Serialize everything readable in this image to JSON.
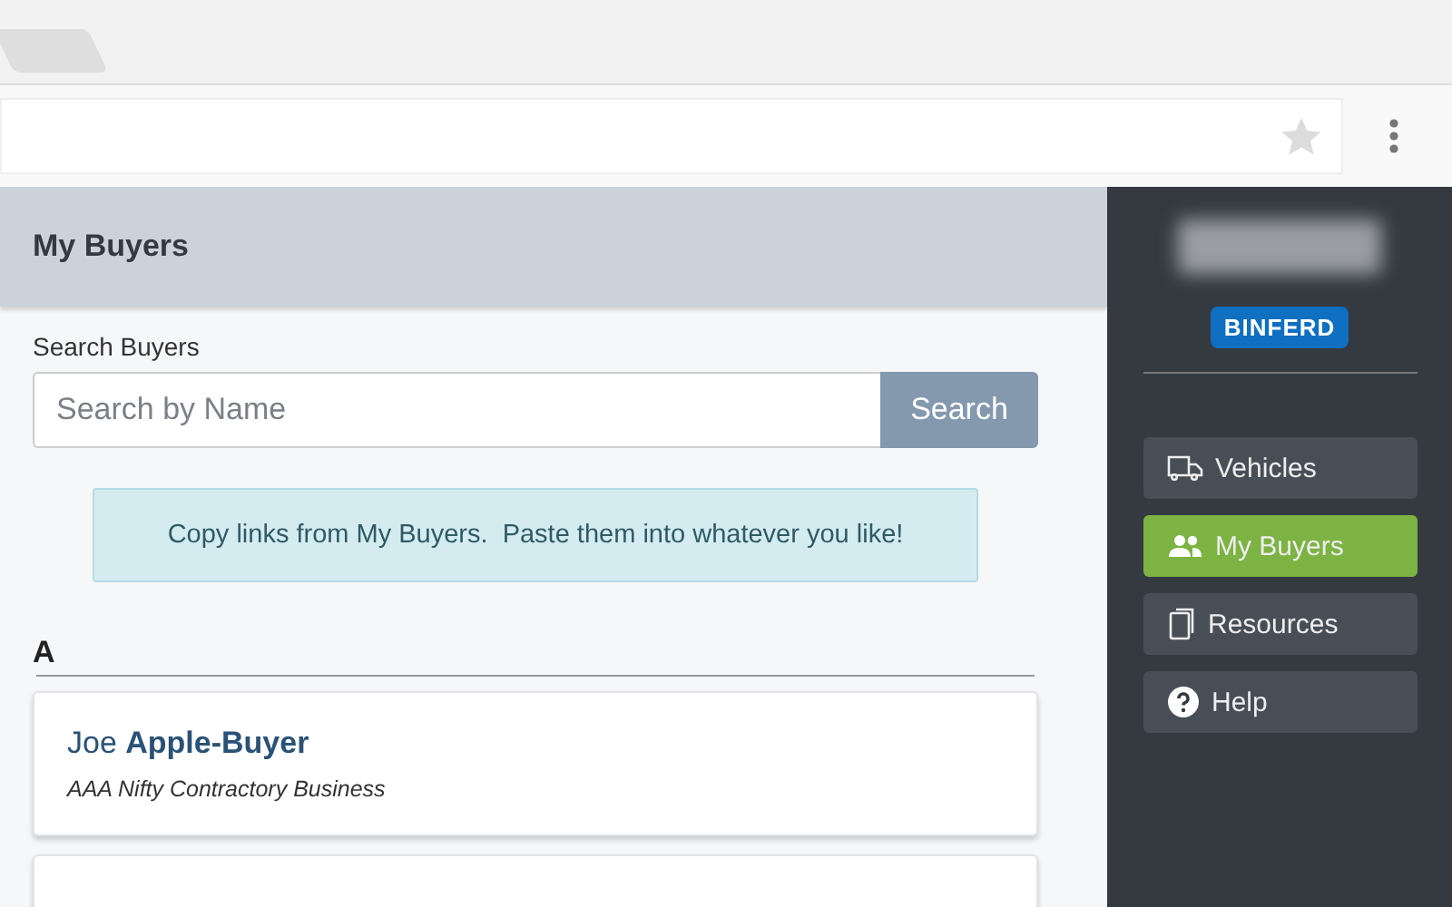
{
  "page": {
    "title": "My Buyers"
  },
  "search": {
    "label": "Search Buyers",
    "placeholder": "Search by Name",
    "button": "Search"
  },
  "notice": "Copy links from My Buyers.  Paste them into whatever you like!",
  "groups": [
    {
      "letter": "A",
      "buyers": [
        {
          "name": "Joe **Apple-Buyer**",
          "company": "AAA Nifty Contractory Business",
          "kind": "full"
        },
        {
          "kind": "cut-off"
        }
      ]
    }
  ],
  "sidebar": {
    "brand": "BINFERD",
    "items": [
      {
        "label": "Vehicles",
        "kind": "truck",
        "selected": false
      },
      {
        "label": "My Buyers",
        "kind": "people",
        "selected": true
      },
      {
        "label": "Resources",
        "kind": "notebook",
        "selected": false
      },
      {
        "label": "Help",
        "kind": "help",
        "selected": false
      }
    ]
  }
}
